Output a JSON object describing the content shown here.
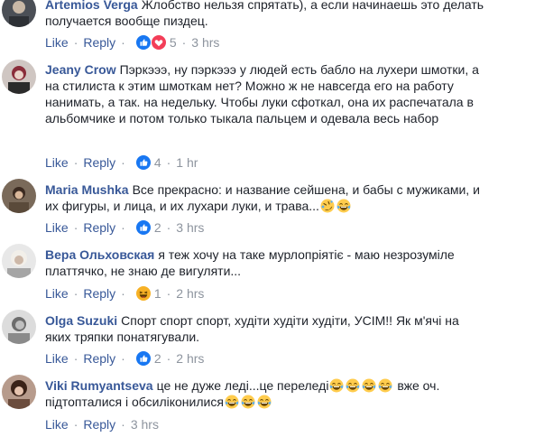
{
  "colors": {
    "link": "#385898",
    "meta": "#8d949e",
    "text": "#1d2129",
    "like_blue": "#1877f2",
    "love_red": "#f33e58",
    "haha_yellow": "#f7b125"
  },
  "labels": {
    "like": "Like",
    "reply": "Reply",
    "sep": "·"
  },
  "comments": [
    {
      "author": "Artemios Verga",
      "text": "Жлобство нельзя спрятать), а если начинаешь это делать получается вообще пиздец.",
      "reactions": [
        "like-icon",
        "love-icon"
      ],
      "count": "5",
      "time": "3 hrs"
    },
    {
      "author": "Jeany Crow",
      "text": "Пэркэээ, ну пэркэээ у людей есть бабло на лухери шмотки, а на стилиста к этим шмоткам нет? Можно ж не навсегда его на работу нанимать, а так. на недельку. Чтобы луки сфоткал, она их распечатала в альбомчике и потом только тыкала пальцем и одевала весь набор",
      "reactions": [
        "like-icon"
      ],
      "count": "4",
      "time": "1 hr"
    },
    {
      "author": "Maria Mushka",
      "text": "Все прекрасно: и название сейшена, и бабы с мужиками, и их фигуры, и лица, и их лухари луки, и трава...",
      "reactions": [
        "like-icon"
      ],
      "count": "2",
      "time": "3 hrs"
    },
    {
      "author": "Вера Ольховская",
      "text": "я теж хочу на таке мурлопріятіє - маю незрозуміле платтячко, не знаю де вигуляти...",
      "reactions": [
        "haha-icon"
      ],
      "count": "1",
      "time": "2 hrs"
    },
    {
      "author": "Olga Suzuki",
      "text": "Спорт спорт спорт, худіти худіти худіти, УСІМ!! Як м'ячі на яких тряпки понатягували.",
      "reactions": [
        "like-icon"
      ],
      "count": "2",
      "time": "2 hrs"
    },
    {
      "author": "Viki Rumyantseva",
      "text_a": "це не дуже леді...це переледі",
      "text_b": "вже оч. підтопталися і обсилiконилися",
      "time": "3 hrs"
    }
  ]
}
